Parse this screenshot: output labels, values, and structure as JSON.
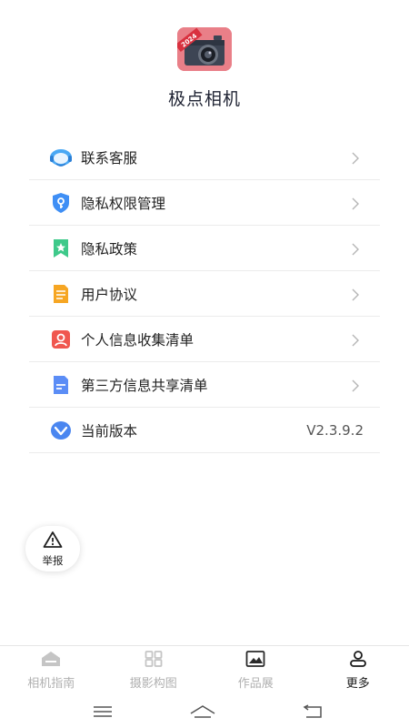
{
  "app": {
    "name": "极点相机",
    "logo_badge": "2024"
  },
  "menu": [
    {
      "label": "联系客服",
      "icon": "headset-icon",
      "color": "#3aa0f0"
    },
    {
      "label": "隐私权限管理",
      "icon": "shield-key-icon",
      "color": "#3f8ff5"
    },
    {
      "label": "隐私政策",
      "icon": "bookmark-star-icon",
      "color": "#3ec98a"
    },
    {
      "label": "用户协议",
      "icon": "document-icon",
      "color": "#f6a623"
    },
    {
      "label": "个人信息收集清单",
      "icon": "user-card-icon",
      "color": "#f0574f"
    },
    {
      "label": "第三方信息共享清单",
      "icon": "file-lines-icon",
      "color": "#5b8df6"
    },
    {
      "label": "当前版本",
      "icon": "version-icon",
      "color": "#4a86f0",
      "value": "V2.3.9.2"
    }
  ],
  "report": {
    "label": "举报",
    "icon": "warning-icon"
  },
  "tabs": [
    {
      "label": "相机指南",
      "icon": "home-icon",
      "active": false
    },
    {
      "label": "摄影构图",
      "icon": "grid-icon",
      "active": false
    },
    {
      "label": "作品展",
      "icon": "image-icon",
      "active": false
    },
    {
      "label": "更多",
      "icon": "person-icon",
      "active": true
    }
  ],
  "system_nav": [
    "menu-icon",
    "home-nav-icon",
    "back-icon"
  ]
}
